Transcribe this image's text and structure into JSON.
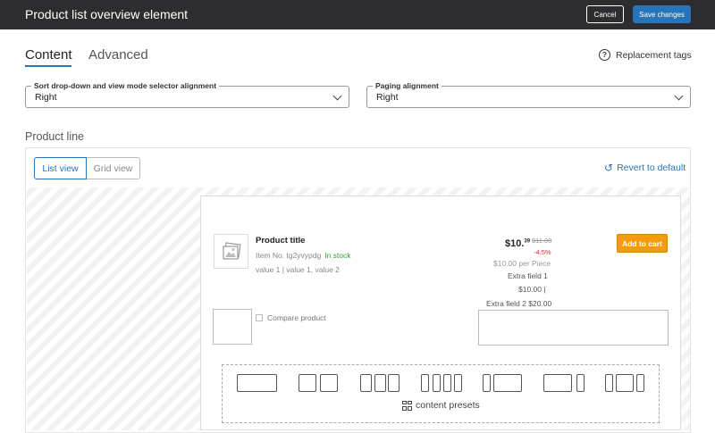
{
  "header": {
    "title": "Product list overview element",
    "cancel_label": "Cancel",
    "save_label": "Save changes"
  },
  "tabs": [
    {
      "label": "Content",
      "active": true
    },
    {
      "label": "Advanced",
      "active": false
    }
  ],
  "replacement_tags": {
    "label": "Replacement tags",
    "icon": "help-circle-icon"
  },
  "fields": {
    "sort_alignment": {
      "label": "Sort drop-down and view mode selector alignment",
      "value": "Right"
    },
    "paging_alignment": {
      "label": "Paging alignment",
      "value": "Right"
    }
  },
  "product_line": {
    "title": "Product line",
    "view_modes": [
      {
        "label": "List view",
        "active": true
      },
      {
        "label": "Grid view",
        "active": false
      }
    ],
    "revert_label": "Revert to default"
  },
  "preview": {
    "product_title": "Product title",
    "item_no": "Item No. tg2yvypdg",
    "stock": "In stock",
    "attributes": "value 1 | value 1, value 2",
    "price_main": "$10.",
    "price_cents": "39",
    "old_price": "$11.00",
    "discount": "-4.5%",
    "per_piece": "$10.00 per Piece",
    "extra_field_1": "Extra field 1",
    "extra_field_1_value": "$10.00  |",
    "extra_field_2": "Extra field 2  $20.00",
    "add_to_cart": "Add to cart",
    "compare": "Compare product",
    "content_presets": "content presets"
  },
  "colors": {
    "accent": "#2874b8",
    "header_bg": "#2d2d30",
    "add_to_cart": "#f39c12",
    "in_stock": "#3aa03a",
    "discount": "#c83232"
  }
}
